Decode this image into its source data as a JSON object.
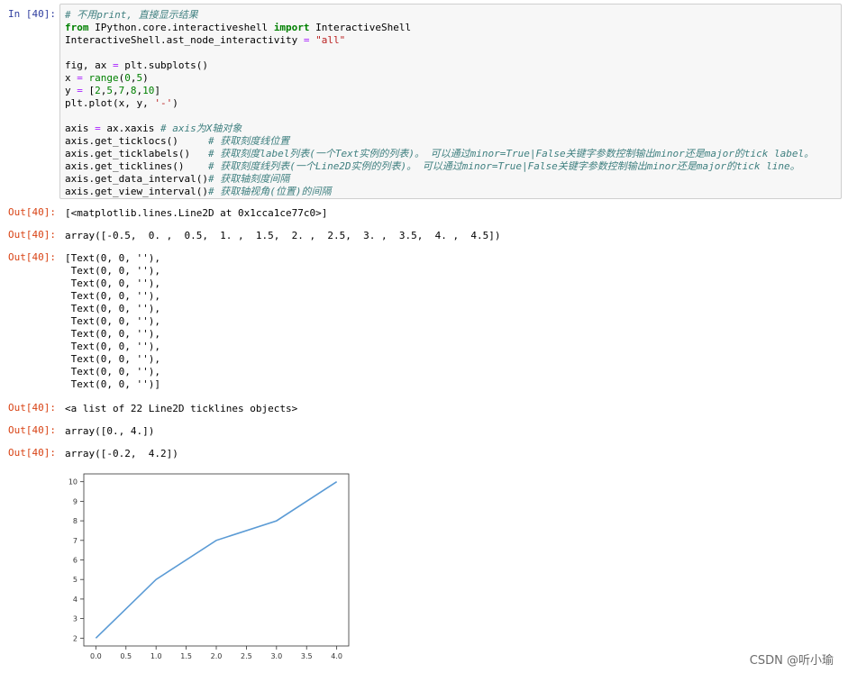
{
  "input": {
    "prompt": "In  [40]:",
    "lines": [
      [
        {
          "t": "# 不用print, 直接显示结果",
          "c": "cm"
        }
      ],
      [
        {
          "t": "from",
          "c": "kw"
        },
        {
          "t": " IPython.core.interactiveshell "
        },
        {
          "t": "import",
          "c": "kw"
        },
        {
          "t": " InteractiveShell"
        }
      ],
      [
        {
          "t": "InteractiveShell.ast_node_interactivity "
        },
        {
          "t": "=",
          "c": "op"
        },
        {
          "t": " "
        },
        {
          "t": "\"all\"",
          "c": "str"
        }
      ],
      [],
      [
        {
          "t": "fig, ax "
        },
        {
          "t": "=",
          "c": "op"
        },
        {
          "t": " plt.subplots()"
        }
      ],
      [
        {
          "t": "x "
        },
        {
          "t": "=",
          "c": "op"
        },
        {
          "t": " "
        },
        {
          "t": "range",
          "c": "bi"
        },
        {
          "t": "("
        },
        {
          "t": "0",
          "c": "num"
        },
        {
          "t": ","
        },
        {
          "t": "5",
          "c": "num"
        },
        {
          "t": ")"
        }
      ],
      [
        {
          "t": "y "
        },
        {
          "t": "=",
          "c": "op"
        },
        {
          "t": " ["
        },
        {
          "t": "2",
          "c": "num"
        },
        {
          "t": ","
        },
        {
          "t": "5",
          "c": "num"
        },
        {
          "t": ","
        },
        {
          "t": "7",
          "c": "num"
        },
        {
          "t": ","
        },
        {
          "t": "8",
          "c": "num"
        },
        {
          "t": ","
        },
        {
          "t": "10",
          "c": "num"
        },
        {
          "t": "]"
        }
      ],
      [
        {
          "t": "plt.plot(x, y, "
        },
        {
          "t": "'-'",
          "c": "str"
        },
        {
          "t": ")"
        }
      ],
      [],
      [
        {
          "t": "axis "
        },
        {
          "t": "=",
          "c": "op"
        },
        {
          "t": " ax.xaxis "
        },
        {
          "t": "# axis为X轴对象",
          "c": "cm"
        }
      ],
      [
        {
          "t": "axis.get_ticklocs()     "
        },
        {
          "t": "# 获取刻度线位置",
          "c": "cm"
        }
      ],
      [
        {
          "t": "axis.get_ticklabels()   "
        },
        {
          "t": "# 获取刻度label列表(一个Text实例的列表)。 可以通过minor=True|False关键字参数控制输出minor还是major的tick label。",
          "c": "cm"
        }
      ],
      [
        {
          "t": "axis.get_ticklines()    "
        },
        {
          "t": "# 获取刻度线列表(一个Line2D实例的列表)。 可以通过minor=True|False关键字参数控制输出minor还是major的tick line。",
          "c": "cm"
        }
      ],
      [
        {
          "t": "axis.get_data_interval()"
        },
        {
          "t": "# 获取轴刻度间隔",
          "c": "cm"
        }
      ],
      [
        {
          "t": "axis.get_view_interval()"
        },
        {
          "t": "# 获取轴视角(位置)的间隔",
          "c": "cm"
        }
      ]
    ]
  },
  "outputs": [
    {
      "prompt": "Out[40]:",
      "text": "[<matplotlib.lines.Line2D at 0x1cca1ce77c0>]"
    },
    {
      "prompt": "Out[40]:",
      "text": "array([-0.5,  0. ,  0.5,  1. ,  1.5,  2. ,  2.5,  3. ,  3.5,  4. ,  4.5])"
    },
    {
      "prompt": "Out[40]:",
      "text": "[Text(0, 0, ''),\n Text(0, 0, ''),\n Text(0, 0, ''),\n Text(0, 0, ''),\n Text(0, 0, ''),\n Text(0, 0, ''),\n Text(0, 0, ''),\n Text(0, 0, ''),\n Text(0, 0, ''),\n Text(0, 0, ''),\n Text(0, 0, '')]"
    },
    {
      "prompt": "Out[40]:",
      "text": "<a list of 22 Line2D ticklines objects>"
    },
    {
      "prompt": "Out[40]:",
      "text": "array([0., 4.])"
    },
    {
      "prompt": "Out[40]:",
      "text": "array([-0.2,  4.2])"
    }
  ],
  "chart_data": {
    "type": "line",
    "x": [
      0,
      1,
      2,
      3,
      4
    ],
    "series": [
      {
        "values": [
          2,
          5,
          7,
          8,
          10
        ]
      }
    ],
    "xlim": [
      -0.2,
      4.2
    ],
    "ylim": [
      1.6,
      10.4
    ],
    "xticks": [
      "0.0",
      "0.5",
      "1.0",
      "1.5",
      "2.0",
      "2.5",
      "3.0",
      "3.5",
      "4.0"
    ],
    "yticks": [
      "2",
      "3",
      "4",
      "5",
      "6",
      "7",
      "8",
      "9",
      "10"
    ],
    "line_color": "#5b9bd5",
    "grid": false,
    "title": "",
    "xlabel": "",
    "ylabel": ""
  },
  "watermark": "CSDN @听小瑜"
}
